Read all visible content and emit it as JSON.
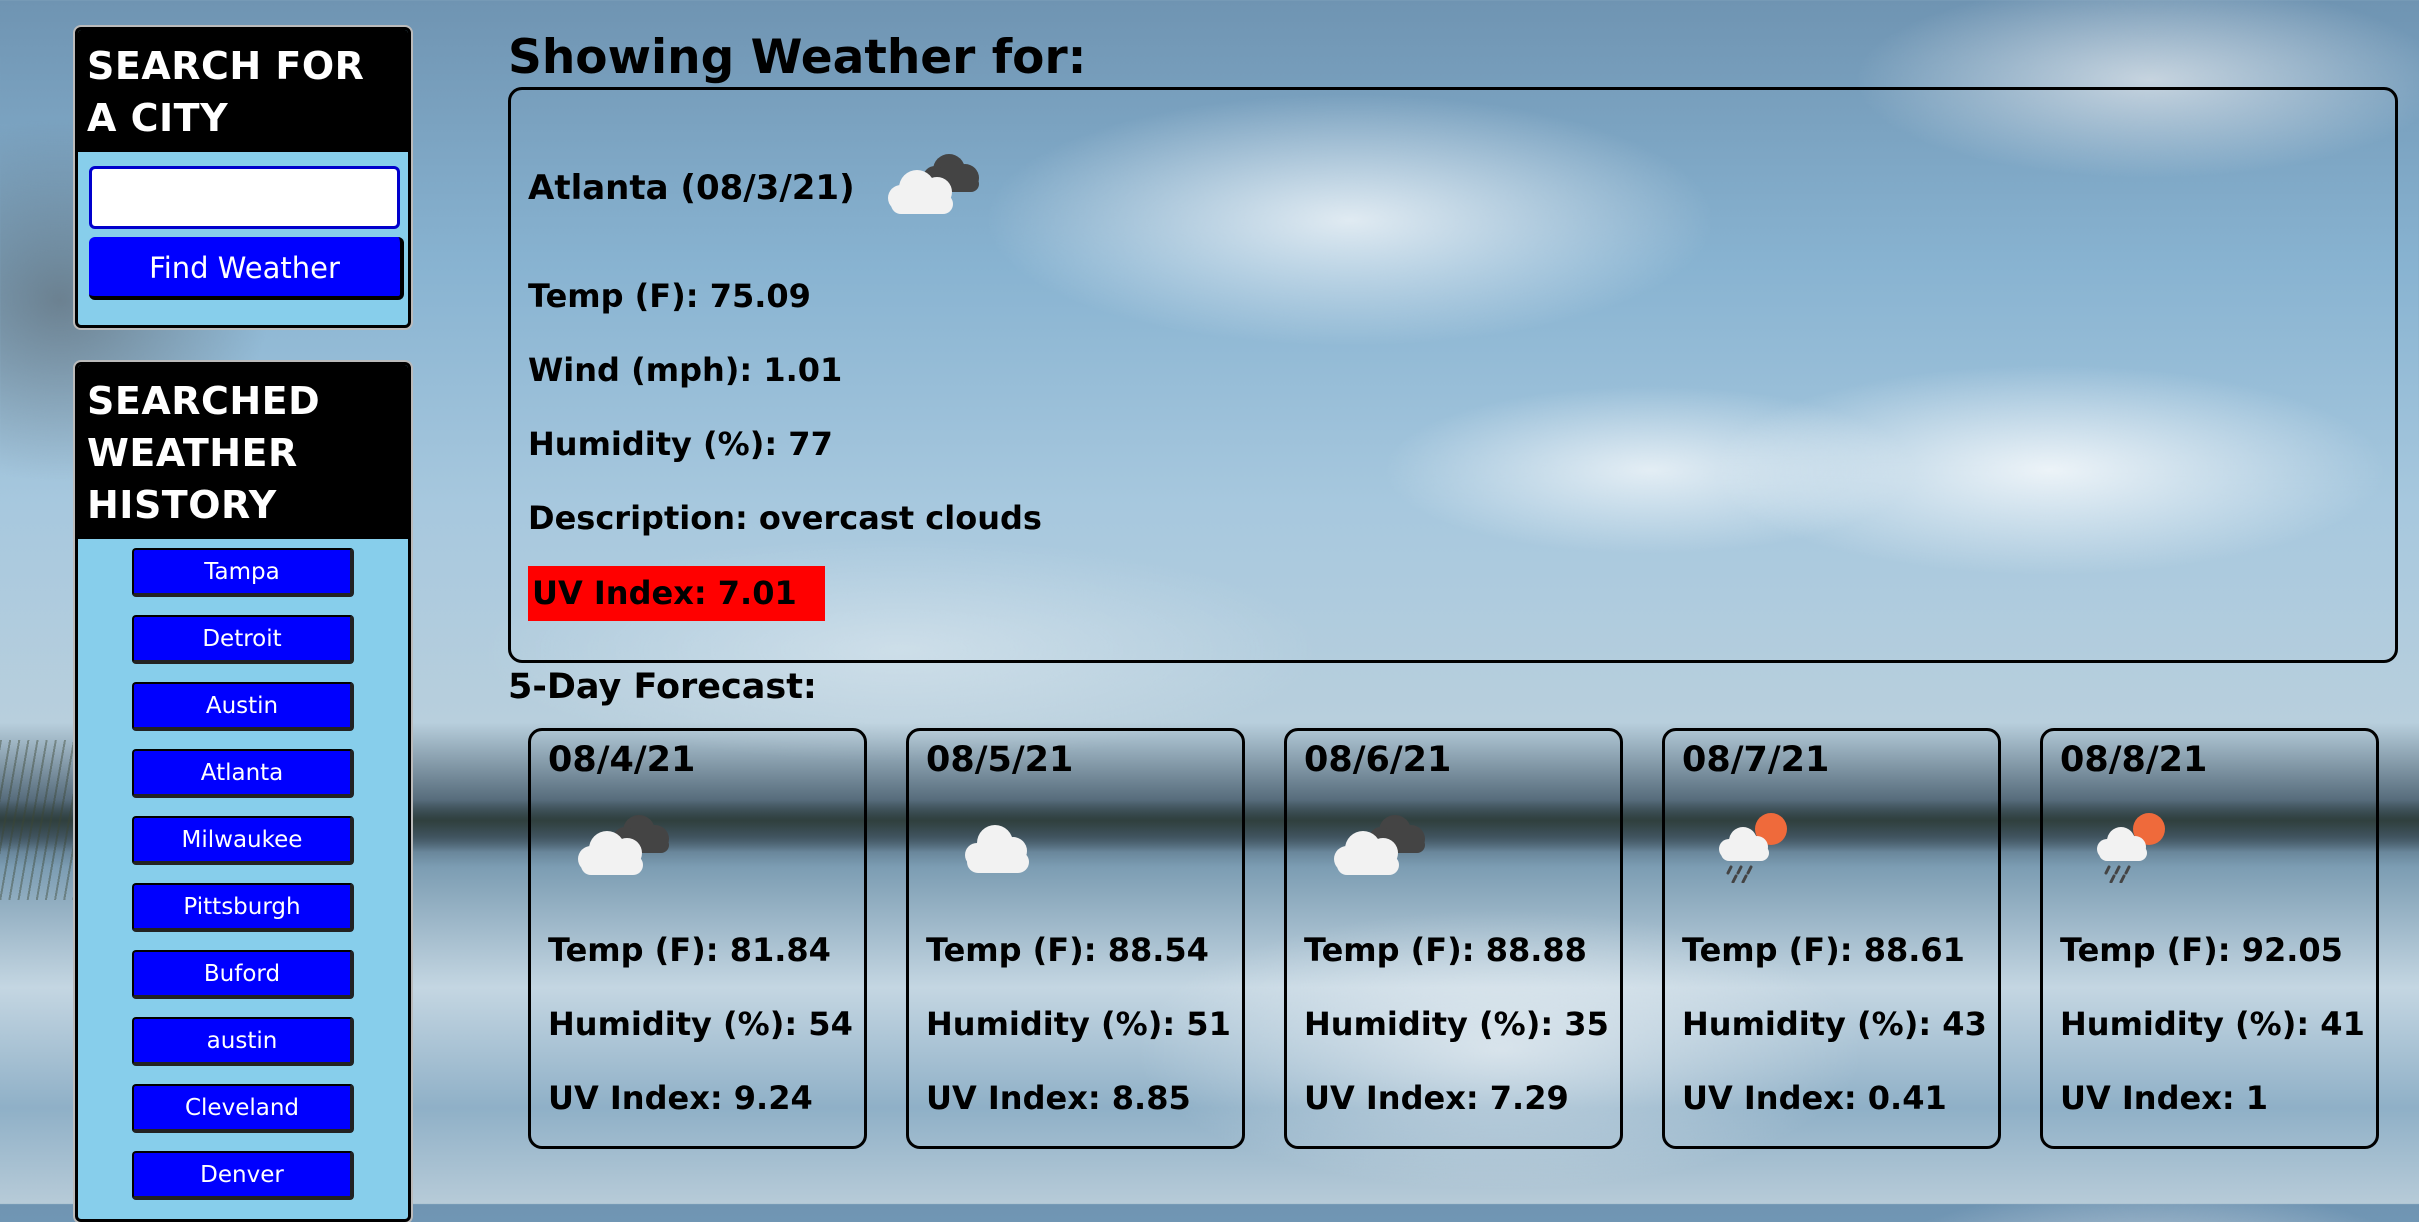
{
  "search": {
    "title": "SEARCH FOR A CITY",
    "input_value": "",
    "button_label": "Find Weather"
  },
  "history": {
    "title": "SEARCHED WEATHER HISTORY",
    "items": [
      "Tampa",
      "Detroit",
      "Austin",
      "Atlanta",
      "Milwaukee",
      "Pittsburgh",
      "Buford",
      "austin",
      "Cleveland",
      "Denver"
    ]
  },
  "main": {
    "title": "Showing Weather for:"
  },
  "current": {
    "city_date": "Atlanta (08/3/21)",
    "icon": "overcast-clouds-icon",
    "temp": "Temp (F): 75.09",
    "wind": "Wind (mph): 1.01",
    "humidity": "Humidity (%): 77",
    "description": "Description: overcast clouds",
    "uv": "UV Index: 7.01",
    "uv_color": "#ff0000"
  },
  "forecast": {
    "title": "5-Day Forecast:",
    "days": [
      {
        "date": "08/4/21",
        "icon": "broken-clouds-icon",
        "temp": "Temp (F): 81.84",
        "humidity": "Humidity (%): 54",
        "uv": "UV Index: 9.24"
      },
      {
        "date": "08/5/21",
        "icon": "few-clouds-icon",
        "temp": "Temp (F): 88.54",
        "humidity": "Humidity (%): 51",
        "uv": "UV Index: 8.85"
      },
      {
        "date": "08/6/21",
        "icon": "broken-clouds-icon",
        "temp": "Temp (F): 88.88",
        "humidity": "Humidity (%): 35",
        "uv": "UV Index: 7.29"
      },
      {
        "date": "08/7/21",
        "icon": "rain-sun-icon",
        "temp": "Temp (F): 88.61",
        "humidity": "Humidity (%): 43",
        "uv": "UV Index: 0.41"
      },
      {
        "date": "08/8/21",
        "icon": "rain-sun-icon",
        "temp": "Temp (F): 92.05",
        "humidity": "Humidity (%): 41",
        "uv": "UV Index: 1"
      }
    ]
  },
  "colors": {
    "panel_bg": "#87ceeb",
    "button_blue": "#0000ff",
    "uv_red": "#ff0000"
  }
}
